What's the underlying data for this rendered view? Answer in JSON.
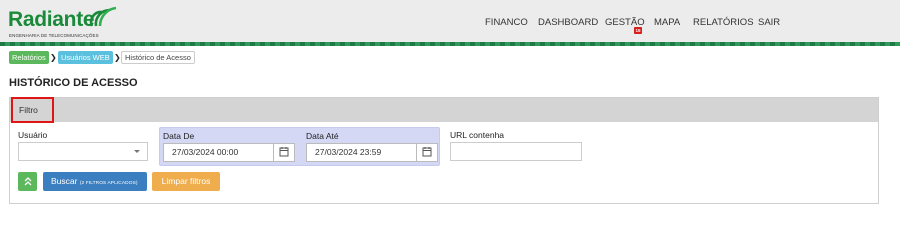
{
  "brand": {
    "name": "Radiante",
    "tagline": "ENGENHARIA DE TELECOMUNICAÇÕES",
    "green": "#1a8a3a"
  },
  "nav": {
    "items": [
      {
        "label": "FINANCO"
      },
      {
        "label": "DASHBOARD"
      },
      {
        "label": "GESTÃO",
        "badge": "15"
      },
      {
        "label": "MAPA"
      },
      {
        "label": "RELATÓRIOS"
      },
      {
        "label": "SAIR"
      }
    ]
  },
  "breadcrumb": {
    "items": [
      "Relatórios",
      "Usuários WEB",
      "Histórico de Acesso"
    ],
    "separator": "❯"
  },
  "page": {
    "title": "HISTÓRICO DE ACESSO"
  },
  "filter": {
    "header": "Filtro",
    "usuario_label": "Usuário",
    "usuario_value": "",
    "data_de_label": "Data De",
    "data_de_value": "27/03/2024 00:00",
    "data_ate_label": "Data Até",
    "data_ate_value": "27/03/2024 23:59",
    "url_label": "URL contenha",
    "url_value": "",
    "collapse_icon": "double-chevron-up",
    "search_label": "Buscar",
    "search_note": "(2 FILTROS APLICADOS)",
    "clear_label": "Limpar filtros"
  },
  "colors": {
    "accent_green": "#5cb85c",
    "accent_blue": "#3c7fc1",
    "accent_orange": "#f0ad4e",
    "breadcrumb_blue": "#5bc0de",
    "highlight_red": "#e01515",
    "badge_red": "#d61f1f"
  }
}
